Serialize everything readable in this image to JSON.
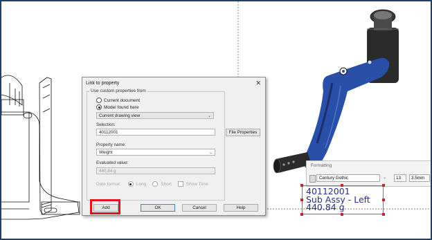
{
  "dialog": {
    "title": "Link to property",
    "close_glyph": "✕",
    "group_label": "Use custom properties from",
    "radio_current_document": "Current document",
    "radio_model_found_here": "Model found here",
    "model_source_select": "Current drawing view",
    "selection_label": "Selection:",
    "selection_value": "40112001",
    "file_properties_button": "File Properties",
    "property_name_label": "Property name:",
    "property_name_value": "Weight",
    "evaluated_value_label": "Evaluated value:",
    "evaluated_value": "440.84 g",
    "date_format_label": "Date format:",
    "date_long": "Long",
    "date_short": "Short",
    "show_time": "Show Time",
    "add_button": "Add",
    "ok_button": "OK",
    "cancel_button": "Cancel",
    "help_button": "Help"
  },
  "formatting": {
    "title": "Formatting",
    "font_value": "Century Gothic",
    "size_value": "13",
    "height_value": "3.5mm"
  },
  "note": {
    "line1": "40112001",
    "line2": "Sub Assy - Left",
    "line3": "440.84 g"
  },
  "colors": {
    "frame_border": "#1f3f66",
    "note_text": "#2c2c8c",
    "highlight_box": "#e0141b",
    "part_blue": "#2a4fa8",
    "part_black": "#2b2b2b"
  },
  "icons": {
    "mouse_cursor": "arrow-pointer-icon",
    "dropdown": "chevron-down-icon"
  }
}
